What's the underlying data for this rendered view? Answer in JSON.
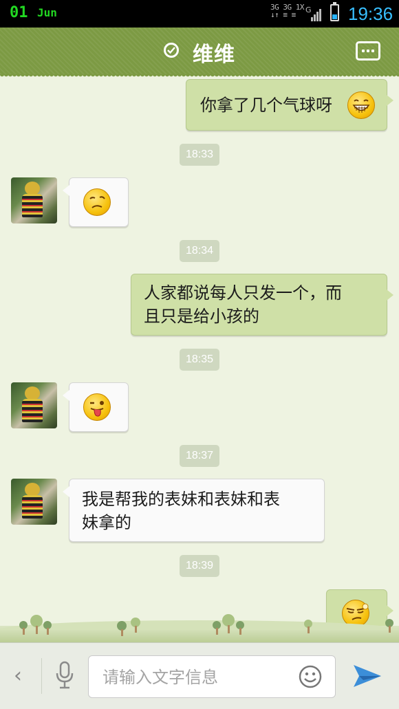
{
  "status_bar": {
    "date_day": "01",
    "date_month": "Jun",
    "network_top": "3G 3G 1X",
    "network_bottom": "↓↑ ≡ ≡",
    "signal_label": "G",
    "time": "19:36"
  },
  "header": {
    "title": "维维",
    "verified_icon": "check-circle-icon",
    "more_icon": "more-dots-icon"
  },
  "messages": [
    {
      "type": "out",
      "text": "你拿了几个气球呀",
      "emoji": "grin-emoji"
    },
    {
      "type": "time",
      "text": "18:33"
    },
    {
      "type": "in",
      "emoji": "awkward-emoji"
    },
    {
      "type": "time",
      "text": "18:34"
    },
    {
      "type": "out",
      "line1": "人家都说每人只发一个，而",
      "line2": "且只是给小孩的"
    },
    {
      "type": "time",
      "text": "18:35"
    },
    {
      "type": "in",
      "emoji": "tongue-wink-emoji"
    },
    {
      "type": "time",
      "text": "18:37"
    },
    {
      "type": "in",
      "line1": "我是帮我的表妹和表妹和表",
      "line2": "妹拿的"
    },
    {
      "type": "time",
      "text": "18:39"
    },
    {
      "type": "out",
      "emoji": "smirk-emoji"
    }
  ],
  "input_bar": {
    "placeholder": "请输入文字信息",
    "value": "",
    "back_icon": "chevron-left-icon",
    "mic_icon": "microphone-icon",
    "emoji_icon": "smiley-icon",
    "send_icon": "send-icon"
  },
  "colors": {
    "header": "#7c9a43",
    "out_bubble": "#cfe0a7",
    "in_bubble": "#fafafa",
    "background": "#eef3e1",
    "clock": "#38bfff",
    "date": "#22d822"
  }
}
